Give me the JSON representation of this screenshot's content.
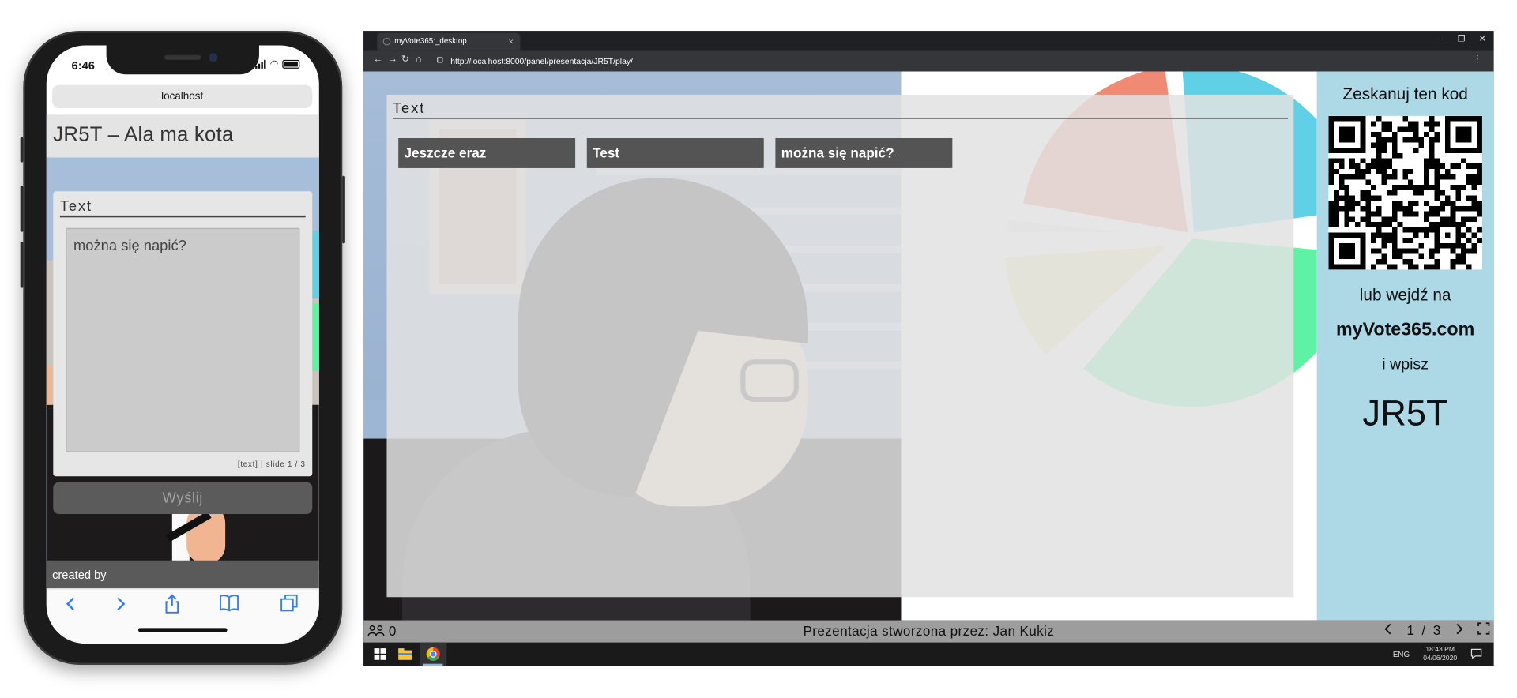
{
  "phone": {
    "status_time": "6:46",
    "url": "localhost",
    "page_title": "JR5T – Ala ma kota",
    "card_title": "Text",
    "textarea_value": "można się napić?",
    "meta": "[text] | slide 1 / 3",
    "send_label": "Wyślij",
    "footer": "created by",
    "toolbar_icons": [
      "chevron-left-icon",
      "chevron-right-icon",
      "share-icon",
      "bookmarks-icon",
      "tabs-icon"
    ],
    "colors": {
      "ios_blue": "#2f7cf6",
      "card_bg": "#e6e6e6",
      "send_bg": "#5b5b5b"
    }
  },
  "browser": {
    "tab_title": "myVote365:_desktop",
    "url": "http://localhost:8000/panel/presentacja/JR5T/play/"
  },
  "slide": {
    "title": "Text",
    "answers": [
      "Jeszcze eraz",
      "Test",
      "można się napić?"
    ]
  },
  "sidebar": {
    "scan_text": "Zeskanuj ten kod",
    "or_text": "lub wejdź na",
    "site": "myVote365.com",
    "type_text": "i wpisz",
    "code": "JR5T",
    "bg_color": "#add8e6"
  },
  "bottom_bar": {
    "users_count": "0",
    "creator_text": "Prezentacja stworzona przez: Jan Kukiz",
    "pager": "1  /  3"
  },
  "taskbar": {
    "lang": "ENG",
    "time": "18:43 PM",
    "date": "04/06/2020"
  },
  "chart_data": {
    "type": "pie",
    "colors": [
      "#f08a74",
      "#5fd0e6",
      "#5ef3a4",
      "#f1e7a3",
      "#e8e8e8"
    ]
  }
}
